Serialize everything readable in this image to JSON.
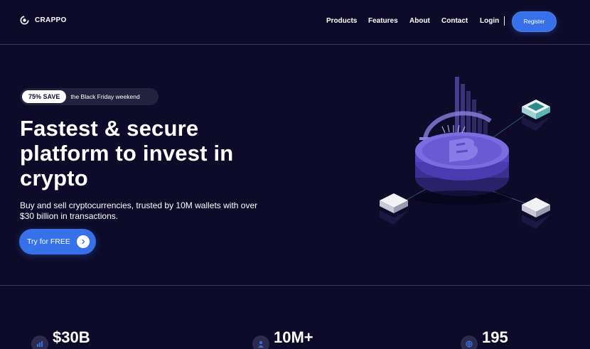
{
  "brand": {
    "name": "CRAPPO"
  },
  "nav": {
    "links": [
      "Products",
      "Features",
      "About",
      "Contact",
      "Login"
    ],
    "register_label": "Register"
  },
  "hero": {
    "badge_pill": "75% SAVE",
    "badge_text": "the Black Friday weekend",
    "title": "Fastest & secure platform to invest in crypto",
    "subtitle": "Buy and sell cryptocurrencies, trusted by 10M wallets with over $30 billion in transactions.",
    "cta_label": "Try for FREE"
  },
  "stats": [
    {
      "value": "$30B",
      "icon": "bar-chart-icon"
    },
    {
      "value": "10M+",
      "icon": "user-icon"
    },
    {
      "value": "195",
      "icon": "globe-icon"
    }
  ],
  "colors": {
    "background": "#0d0b29",
    "accent": "#3671e9",
    "divider": "#3a3860",
    "coin": "#6f5fd6"
  }
}
